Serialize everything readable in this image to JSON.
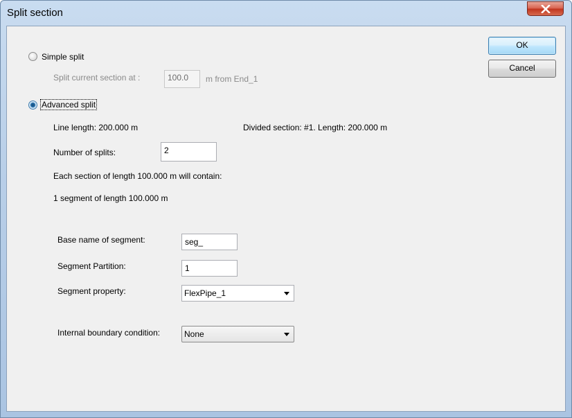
{
  "window": {
    "title": "Split section"
  },
  "buttons": {
    "ok": "OK",
    "cancel": "Cancel"
  },
  "simple": {
    "radio_label": "Simple split",
    "at_label": "Split current section at :",
    "at_value": "100.0",
    "unit_label": "m from End_1"
  },
  "advanced": {
    "radio_label": "Advanced split",
    "line_length": "Line length:  200.000 m",
    "divided_section": "Divided section: #1. Length: 200.000 m",
    "num_splits_label": "Number of splits:",
    "num_splits_value": "2",
    "each_section": "Each section of length 100.000 m will contain:",
    "segment_summary": "1 segment of length  100.000 m"
  },
  "segment": {
    "base_name_label": "Base name of segment:",
    "base_name_value": "seg_",
    "partition_label": "Segment Partition:",
    "partition_value": "1",
    "property_label": "Segment property:",
    "property_value": "FlexPipe_1",
    "boundary_label": "Internal boundary condition:",
    "boundary_value": "None"
  },
  "state": {
    "selected_mode": "advanced"
  },
  "icons": {
    "close": "close-icon",
    "dropdown": "chevron-down-icon",
    "radio": "radio-icon"
  }
}
